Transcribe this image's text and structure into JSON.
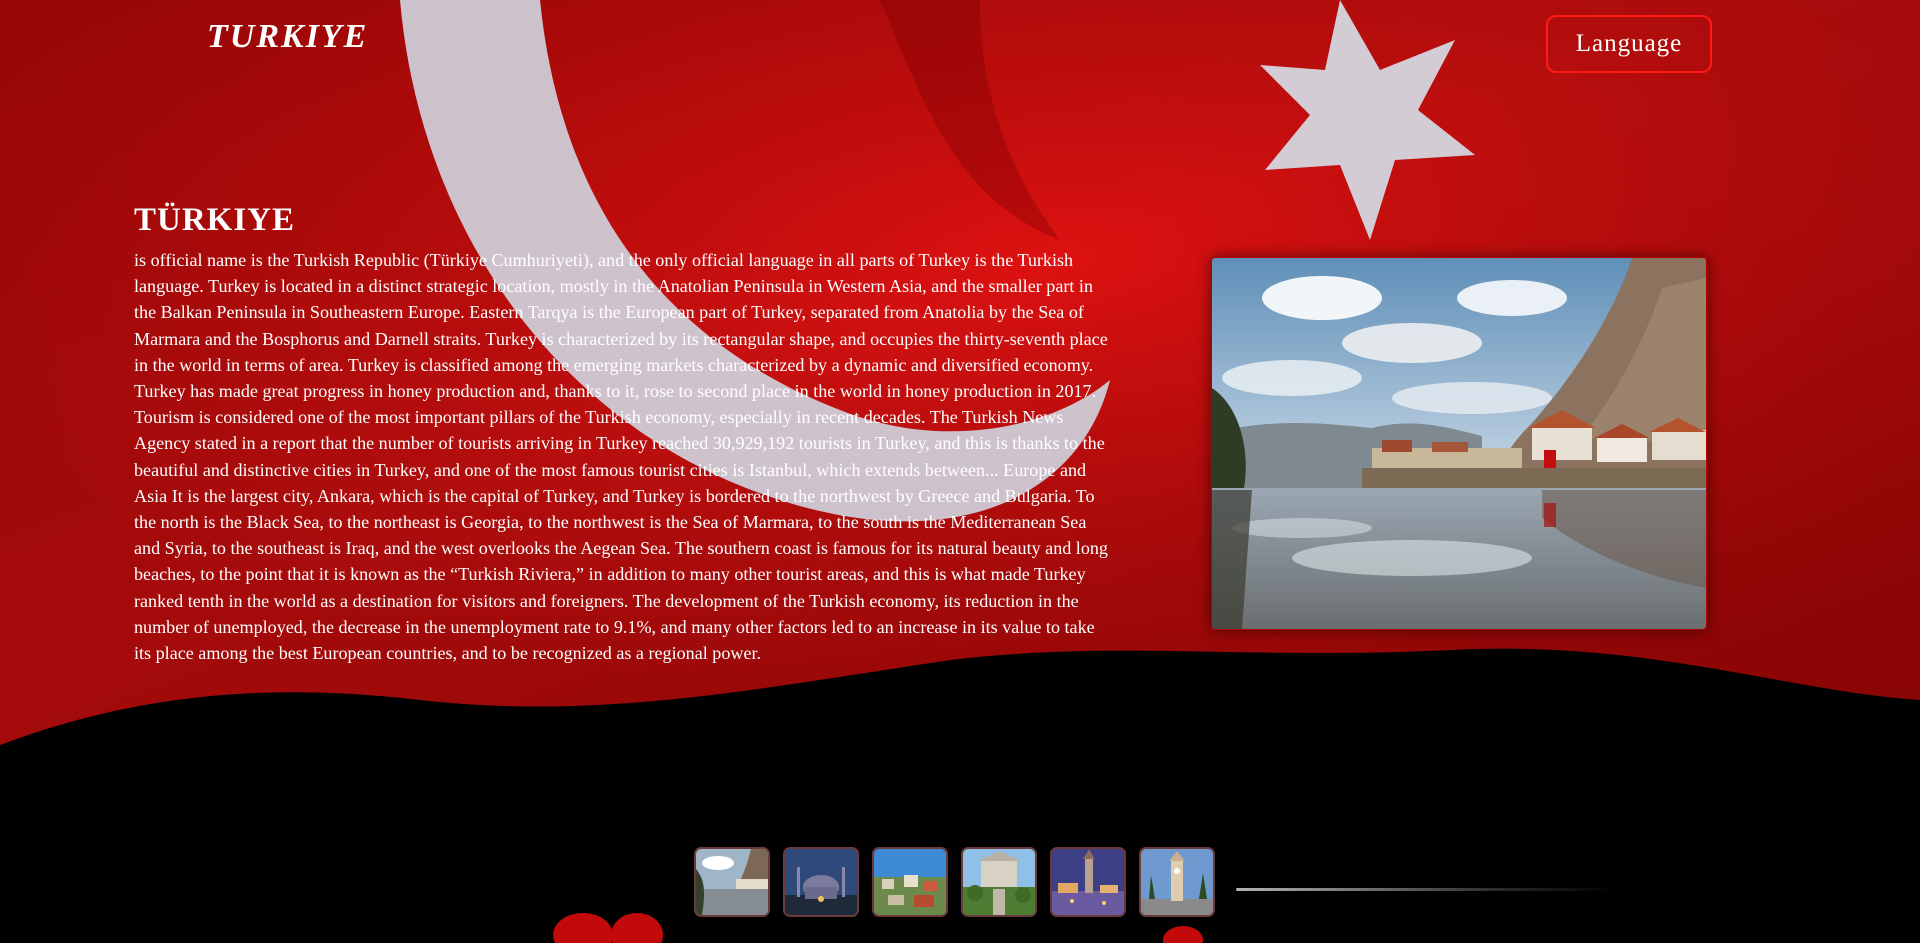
{
  "header": {
    "brand": "TURKIYE",
    "language_button": "Language"
  },
  "main": {
    "title": "TÜRKIYE",
    "paragraph": "is official name is the Turkish Republic (Türkiye Cumhuriyeti), and the only official language in all parts of Turkey is the Turkish language. Turkey is located in a distinct strategic location, mostly in the Anatolian Peninsula in Western Asia, and the smaller part in the Balkan Peninsula in Southeastern Europe. Eastern Tarqya is the European part of Turkey, separated from Anatolia by the Sea of Marmara and the Bosphorus and Darnell straits. Turkey is characterized by its rectangular shape, and occupies the thirty-seventh place in the world in terms of area. Turkey is classified among the emerging markets characterized by a dynamic and diversified economy. Turkey has made great progress in honey production and, thanks to it, rose to second place in the world in honey production in 2017. Tourism is considered one of the most important pillars of the Turkish economy, especially in recent decades. The Turkish News Agency stated in a report that the number of tourists arriving in Turkey reached 30,929,192 tourists in Turkey, and this is thanks to the beautiful and distinctive cities in Turkey, and one of the most famous tourist cities is Istanbul, which extends between... Europe and Asia It is the largest city, Ankara, which is the capital of Turkey, and Turkey is bordered to the northwest by Greece and Bulgaria. To the north is the Black Sea, to the northeast is Georgia, to the northwest is the Sea of Marmara, to the south is the Mediterranean Sea and Syria, to the southeast is Iraq, and the west overlooks the Aegean Sea. The southern coast is famous for its natural beauty and long beaches, to the point that it is known as the “Turkish Riviera,” in addition to many other tourist areas, and this is what made Turkey ranked tenth in the world as a destination for visitors and foreigners. The development of the Turkish economy, its reduction in the number of unemployed, the decrease in the unemployment rate to 9.1%, and many other factors led to an increase in its value to take its place among the best European countries, and to be recognized as a regional power."
  },
  "colors": {
    "flag_red": "#d40d0d",
    "button_border": "#ff1a1a",
    "text": "#ffffff"
  },
  "gallery": {
    "thumbnails": [
      "river-town-thumb",
      "mosque-thumb",
      "city-view-thumb",
      "garden-palace-thumb",
      "night-city-thumb",
      "clock-tower-thumb"
    ]
  }
}
